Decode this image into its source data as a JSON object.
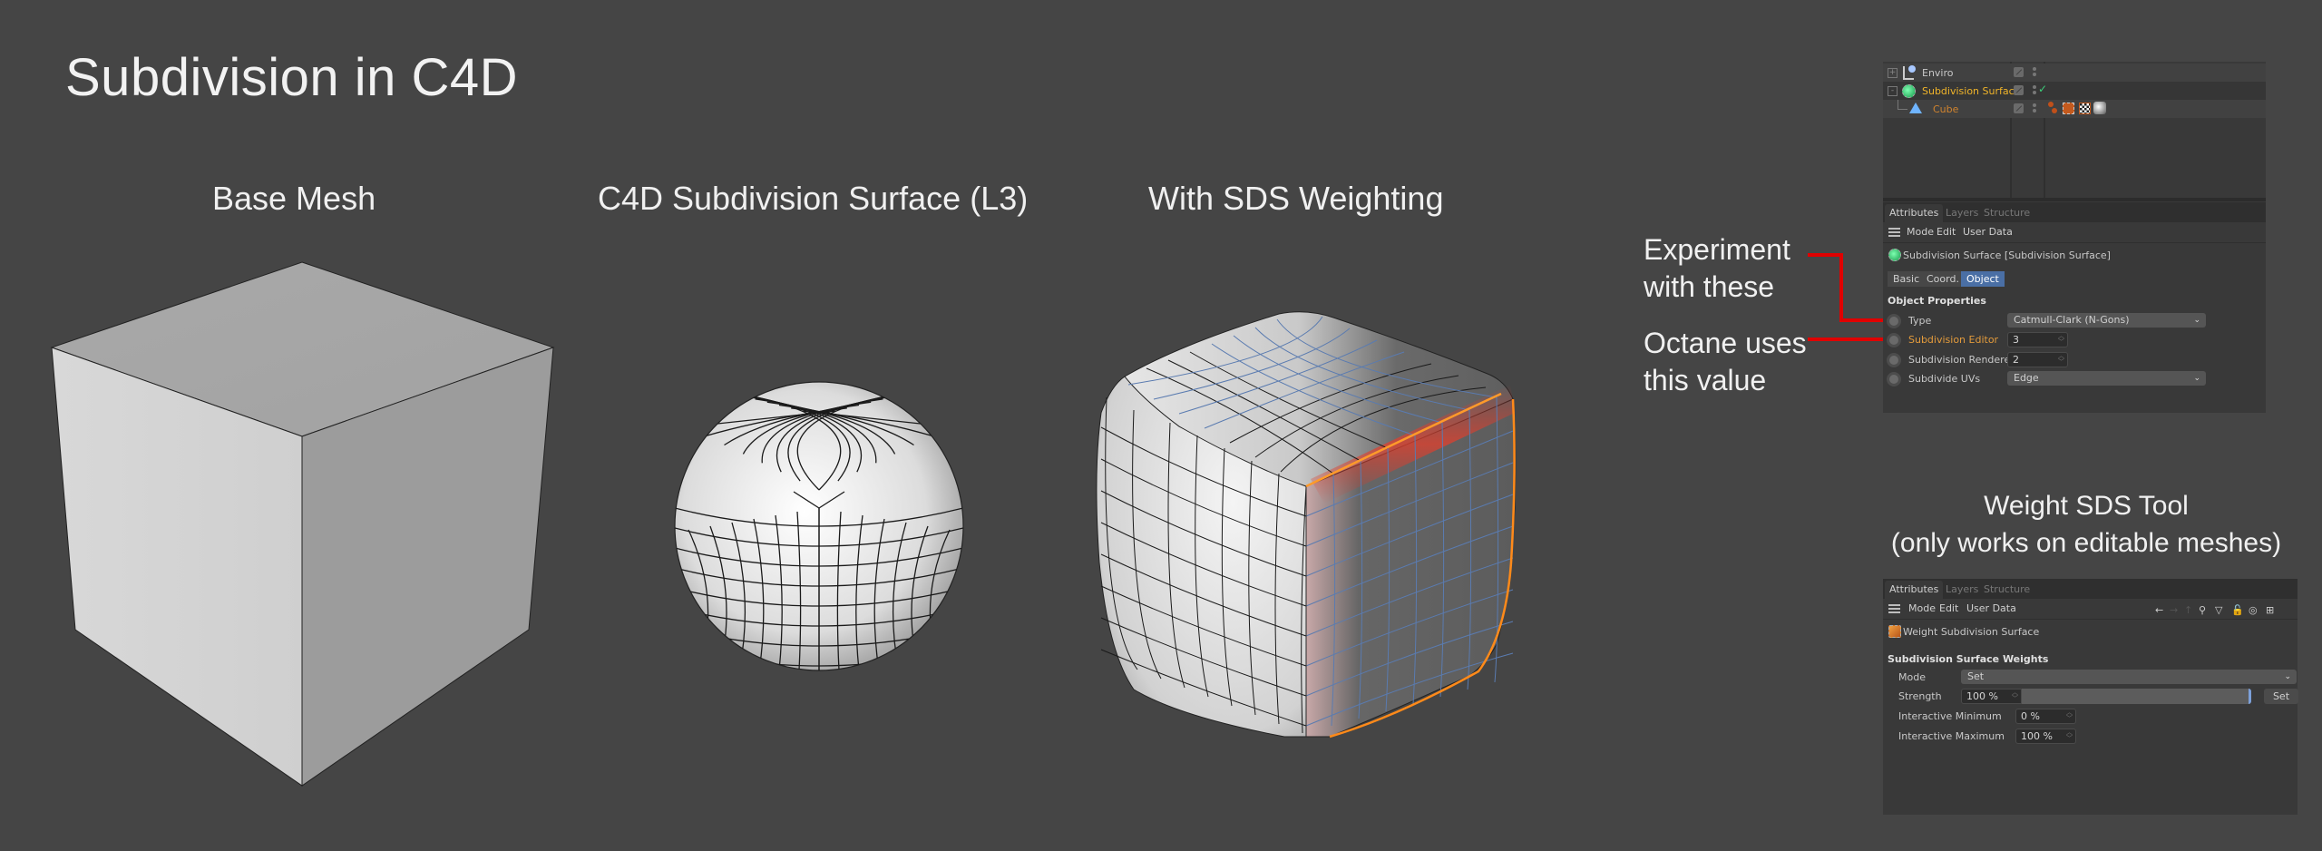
{
  "slide": {
    "title": "Subdivision in C4D",
    "captions": {
      "base_mesh": "Base Mesh",
      "subdivision_surface": "C4D Subdivision Surface (L3)",
      "sds_weighting": "With SDS Weighting",
      "weight_tool_line1": "Weight SDS Tool",
      "weight_tool_line2": "(only works on editable meshes)"
    },
    "annotations": {
      "experiment_line1": "Experiment",
      "experiment_line2": "with these",
      "octane_line1": "Octane uses",
      "octane_line2": "this value"
    },
    "colors": {
      "background": "#454545",
      "annotation_line": "#e00000",
      "weight_highlight": "#ff7a1a"
    }
  },
  "object_manager": {
    "objects": [
      {
        "name": "Enviro",
        "icon": "environment-icon",
        "color": "#c8c8c8",
        "expander": "+"
      },
      {
        "name": "Subdivision Surface",
        "icon": "subdivision-surface-icon",
        "color": "#f0b429",
        "expander": "-",
        "enabled_check": "✓"
      },
      {
        "name": "Cube",
        "icon": "polygon-object-icon",
        "color": "#d0832e",
        "tags": [
          "selection-tag-icon",
          "weight-sds-tag-icon",
          "texture-tag-icon",
          "material-tag-icon"
        ]
      }
    ]
  },
  "attributes_top": {
    "tabs": [
      "Attributes",
      "Layers",
      "Structure"
    ],
    "active_tab": "Attributes",
    "menu": [
      "Mode",
      "Edit",
      "User Data"
    ],
    "object_title": "Subdivision Surface [Subdivision Surface]",
    "subtabs": [
      "Basic",
      "Coord.",
      "Object"
    ],
    "active_subtab": "Object",
    "section": "Object Properties",
    "properties": [
      {
        "label": "Type",
        "value": "Catmull-Clark (N-Gons)",
        "kind": "dropdown"
      },
      {
        "label": "Subdivision Editor",
        "value": "3",
        "kind": "number",
        "highlight": true
      },
      {
        "label": "Subdivision Renderer",
        "value": "2",
        "kind": "number"
      },
      {
        "label": "Subdivide UVs",
        "value": "Edge",
        "kind": "dropdown"
      }
    ]
  },
  "attributes_bottom": {
    "tabs": [
      "Attributes",
      "Layers",
      "Structure"
    ],
    "active_tab": "Attributes",
    "menu": [
      "Mode",
      "Edit",
      "User Data"
    ],
    "toolbar_icons": [
      "←",
      "→",
      "↑",
      "⚲",
      "▽",
      "🔓",
      "◎",
      "⊞"
    ],
    "tool_title": "Weight Subdivision Surface",
    "section": "Subdivision Surface Weights",
    "mode_label": "Mode",
    "mode_value": "Set",
    "strength_label": "Strength",
    "strength_value": "100 %",
    "strength_fraction": 1.0,
    "set_button": "Set",
    "interactive_min_label": "Interactive Minimum",
    "interactive_min_value": "0 %",
    "interactive_max_label": "Interactive Maximum",
    "interactive_max_value": "100 %"
  }
}
